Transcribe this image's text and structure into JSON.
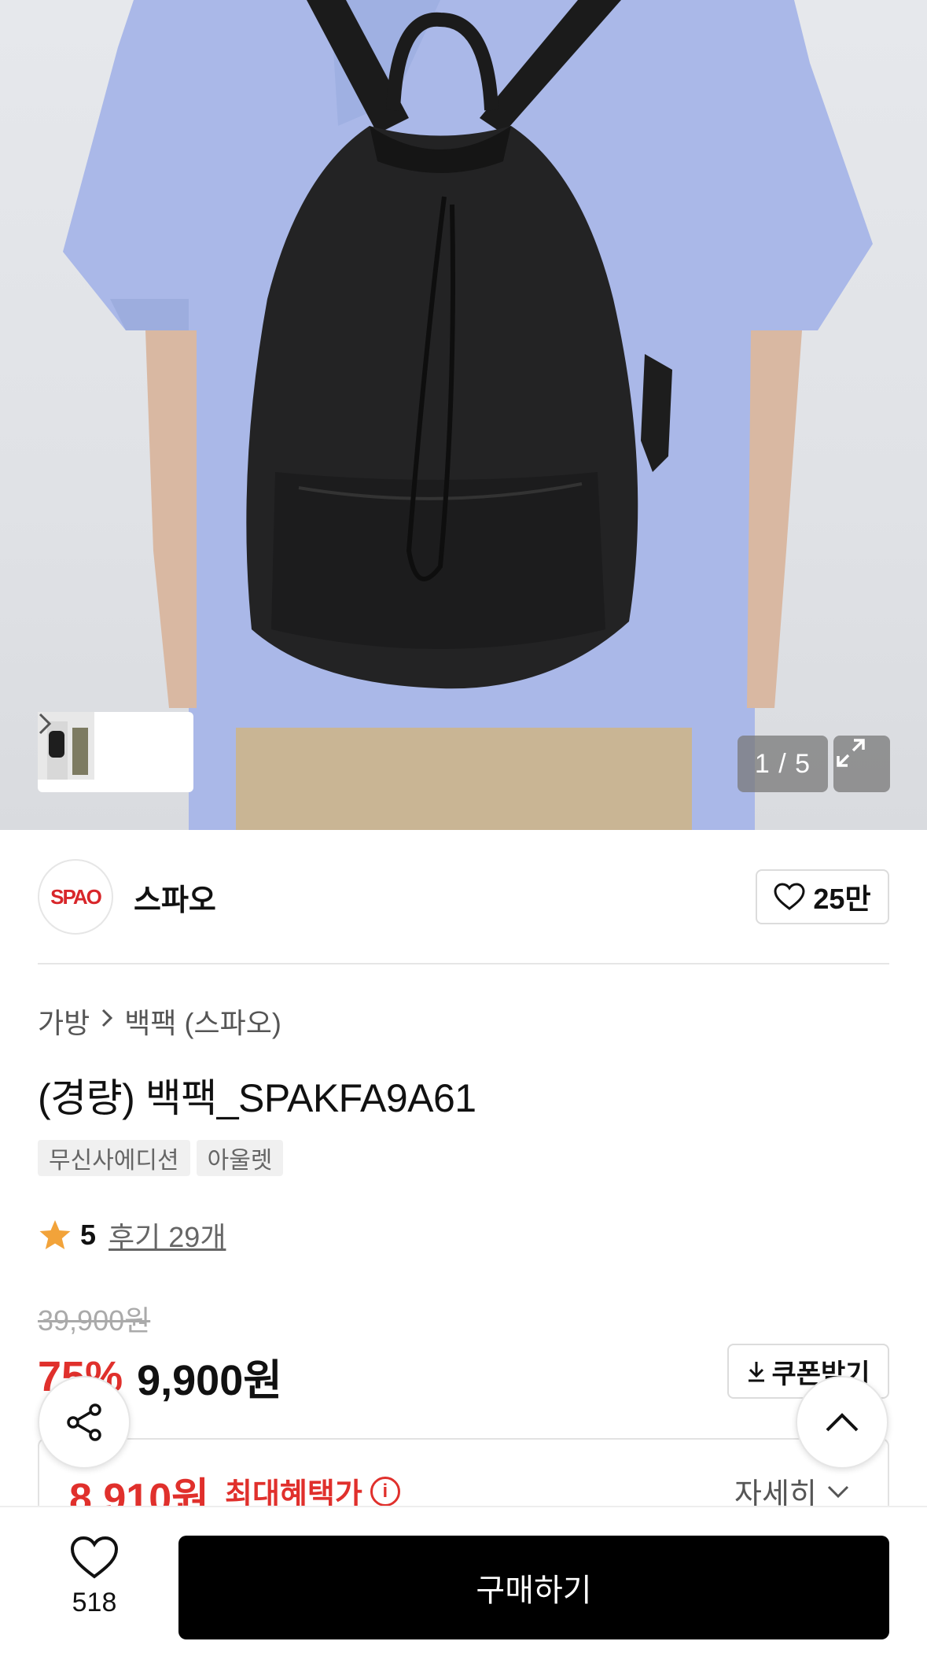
{
  "gallery": {
    "counter": "1 / 5",
    "thumbnail_strip_icon": "chevron-right-icon",
    "expand_icon": "expand-icon"
  },
  "brand": {
    "logo_text": "SPAO",
    "name": "스파오",
    "like_count": "25만"
  },
  "breadcrumb": {
    "category": "가방",
    "subcategory": "백팩 (스파오)"
  },
  "product": {
    "title": "(경량) 백팩_SPAKFA9A61",
    "tags": [
      "무신사에디션",
      "아울렛"
    ]
  },
  "rating": {
    "score": "5",
    "reviews": "후기 29개"
  },
  "price": {
    "original": "39,900원",
    "discount": "75%",
    "sale": "9,900원",
    "coupon_label": "쿠폰받기"
  },
  "benefit": {
    "price": "8,910원",
    "label": "최대혜택가",
    "detail": "자세히"
  },
  "bottom": {
    "wish_count": "518",
    "buy_label": "구매하기"
  },
  "colors": {
    "accent_red": "#e0302c",
    "buy_button": "#000000"
  }
}
